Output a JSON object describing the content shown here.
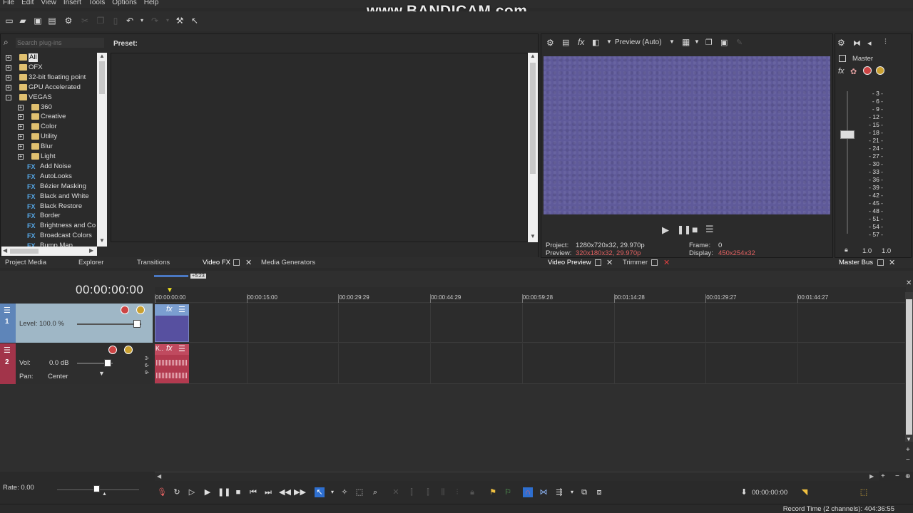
{
  "menu": [
    "File",
    "Edit",
    "View",
    "Insert",
    "Tools",
    "Options",
    "Help"
  ],
  "watermark": "www.BANDICAM.com",
  "plugins": {
    "search_placeholder": "Search plug-ins",
    "preset_label": "Preset:",
    "tree": [
      {
        "label": "All",
        "level": 0,
        "kind": "folder",
        "exp": "+",
        "selected": true
      },
      {
        "label": "OFX",
        "level": 0,
        "kind": "folder",
        "exp": "+"
      },
      {
        "label": "32-bit floating point",
        "level": 0,
        "kind": "folder",
        "exp": "+"
      },
      {
        "label": "GPU Accelerated",
        "level": 0,
        "kind": "folder",
        "exp": "+"
      },
      {
        "label": "VEGAS",
        "level": 0,
        "kind": "folder",
        "exp": "-"
      },
      {
        "label": "360",
        "level": 1,
        "kind": "folder",
        "exp": "+"
      },
      {
        "label": "Creative",
        "level": 1,
        "kind": "folder",
        "exp": "+"
      },
      {
        "label": "Color",
        "level": 1,
        "kind": "folder",
        "exp": "+"
      },
      {
        "label": "Utility",
        "level": 1,
        "kind": "folder",
        "exp": "+"
      },
      {
        "label": "Blur",
        "level": 1,
        "kind": "folder",
        "exp": "+"
      },
      {
        "label": "Light",
        "level": 1,
        "kind": "folder",
        "exp": "+"
      },
      {
        "label": "Add Noise",
        "level": 1,
        "kind": "fx"
      },
      {
        "label": "AutoLooks",
        "level": 1,
        "kind": "fx"
      },
      {
        "label": "Bézier Masking",
        "level": 1,
        "kind": "fx"
      },
      {
        "label": "Black and White",
        "level": 1,
        "kind": "fx"
      },
      {
        "label": "Black Restore",
        "level": 1,
        "kind": "fx"
      },
      {
        "label": "Border",
        "level": 1,
        "kind": "fx"
      },
      {
        "label": "Brightness and Co",
        "level": 1,
        "kind": "fx"
      },
      {
        "label": "Broadcast Colors",
        "level": 1,
        "kind": "fx"
      },
      {
        "label": "Bump Map",
        "level": 1,
        "kind": "fx"
      }
    ]
  },
  "tabs_left": [
    {
      "label": "Project Media"
    },
    {
      "label": "Explorer"
    },
    {
      "label": "Transitions"
    },
    {
      "label": "Video FX"
    },
    {
      "label": "Media Generators"
    }
  ],
  "preview": {
    "mode": "Preview (Auto)",
    "project_label": "Project:",
    "project_value": "1280x720x32, 29.970p",
    "preview_label": "Preview:",
    "preview_value": "320x180x32, 29.970p",
    "frame_label": "Frame:",
    "frame_value": "0",
    "display_label": "Display:",
    "display_value": "450x254x32",
    "screen_color": "#5f5a9a"
  },
  "tabs_preview": [
    {
      "label": "Video Preview"
    },
    {
      "label": "Trimmer"
    }
  ],
  "master": {
    "title": "Master",
    "tab": "Master Bus",
    "meter_ticks": [
      "3",
      "6",
      "9",
      "12",
      "15",
      "18",
      "21",
      "24",
      "27",
      "30",
      "33",
      "36",
      "39",
      "42",
      "45",
      "48",
      "51",
      "54",
      "57"
    ],
    "left_value": "1.0",
    "right_value": "1.0"
  },
  "timeline": {
    "time": "00:00:00:00",
    "region_label": "+5:23",
    "ruler": [
      "00:00:00:00",
      "00:00:15:00",
      "00:00:29:29",
      "00:00:44:29",
      "00:00:59:28",
      "00:01:14:28",
      "00:01:29:27",
      "00:01:44:27"
    ],
    "track1": {
      "number": "1",
      "level": "Level: 100.0 %"
    },
    "track2": {
      "number": "2",
      "vol_label": "Vol:",
      "vol_value": "0.0 dB",
      "pan_label": "Pan:",
      "pan_value": "Center",
      "event_label": "K..",
      "channel_labels": [
        "3-",
        "6-",
        "9-"
      ]
    }
  },
  "transport": {
    "rate": "Rate: 0.00",
    "position": "00:00:00:00"
  },
  "status": {
    "record_time": "Record Time (2 channels): 404:36:55"
  },
  "colors": {
    "video_track": "#5e85b9",
    "audio_track": "#a2344a",
    "video_event": "#5750a0",
    "audio_event": "#b23a4f"
  }
}
